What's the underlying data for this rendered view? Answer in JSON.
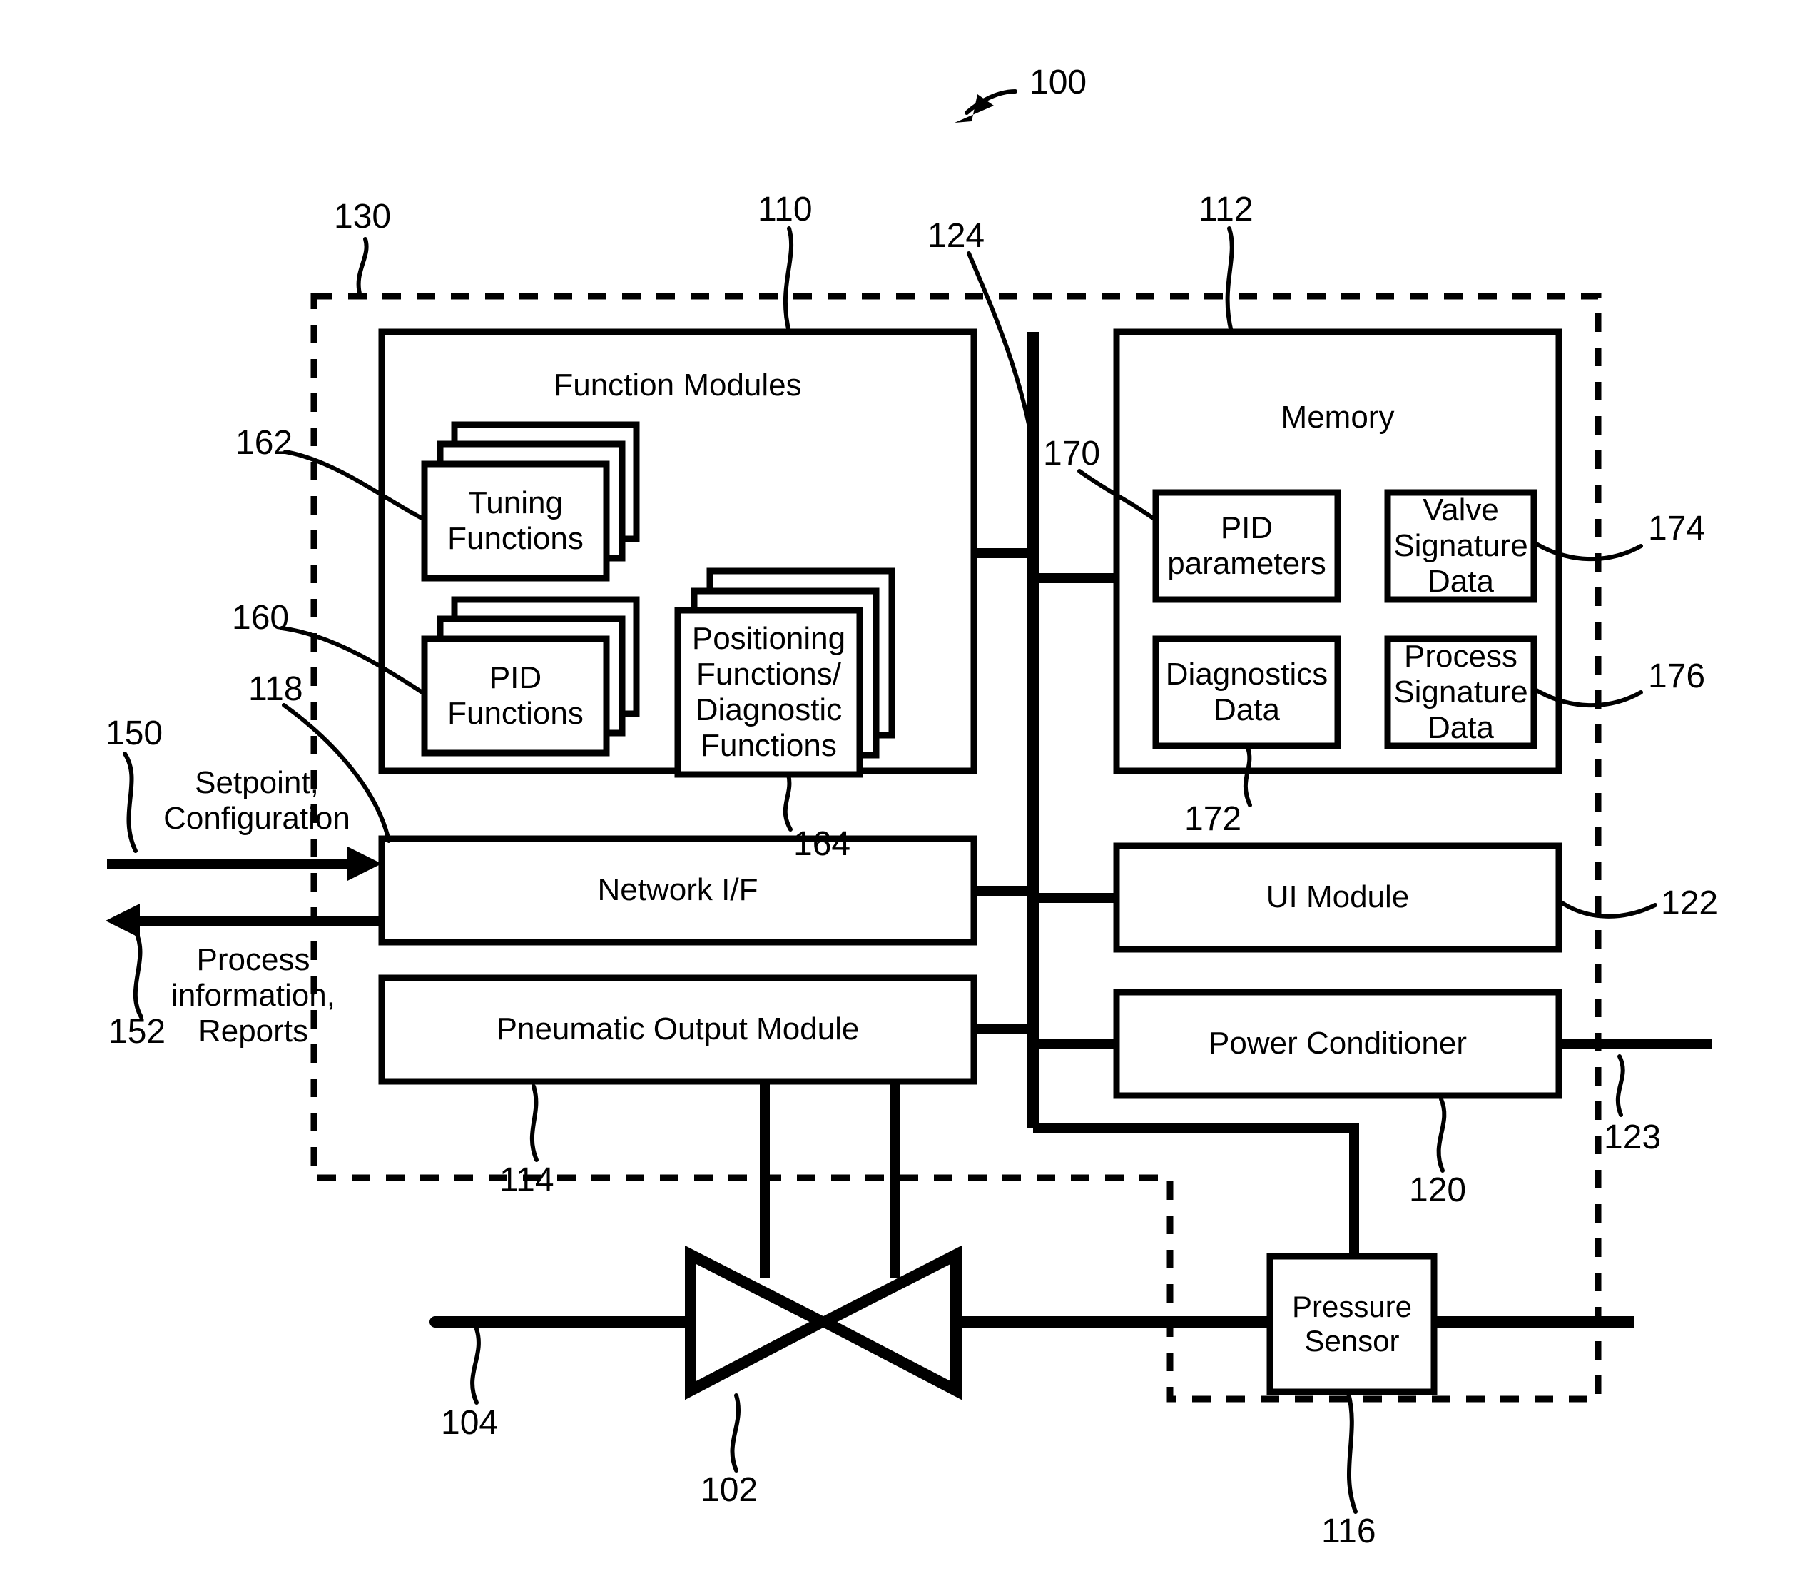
{
  "figure": {
    "root_ref": "100",
    "refs": {
      "system": "100",
      "valve": "102",
      "pipe_inlet": "104",
      "function_modules": "110",
      "memory": "112",
      "pneumatic_output_module": "114",
      "pressure_sensor": "116",
      "network_if": "118",
      "power_conditioner": "120",
      "power_output": "123",
      "ui_module": "122",
      "bus": "124",
      "controller_boundary": "130",
      "pid_functions": "160",
      "tuning_functions": "162",
      "positioning_diagnostic_functions": "164",
      "pid_parameters": "170",
      "diagnostics_data": "172",
      "valve_signature_data": "174",
      "process_signature_data": "176",
      "input_signal": "150",
      "output_signal": "152"
    }
  },
  "blocks": {
    "function_modules": "Function Modules",
    "memory": "Memory",
    "tuning_functions": "Tuning\nFunctions",
    "pid_functions": "PID\nFunctions",
    "positioning_diagnostic_functions": "Positioning\nFunctions/\nDiagnostic\nFunctions",
    "pid_parameters": "PID\nparameters",
    "valve_signature_data": "Valve\nSignature\nData",
    "diagnostics_data": "Diagnostics\nData",
    "process_signature_data": "Process\nSignature\nData",
    "network_if": "Network I/F",
    "ui_module": "UI Module",
    "pneumatic_output_module": "Pneumatic Output Module",
    "power_conditioner": "Power Conditioner",
    "pressure_sensor": "Pressure\nSensor"
  },
  "signals": {
    "inbound": "Setpoint,\nConfiguration",
    "outbound": "Process\ninformation,\nReports"
  },
  "colors": {
    "stroke": "#000000",
    "background": "#ffffff"
  }
}
